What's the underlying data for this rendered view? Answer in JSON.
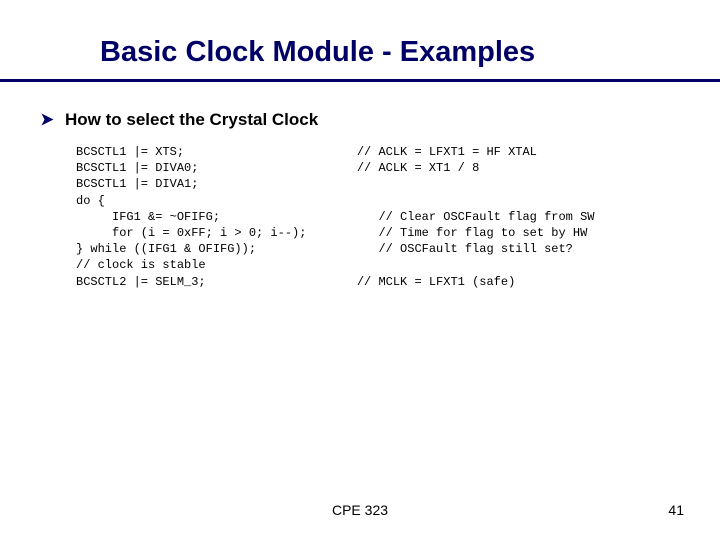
{
  "title": "Basic Clock Module - Examples",
  "bullet": "How to select the Crystal Clock",
  "code": "BCSCTL1 |= XTS;                        // ACLK = LFXT1 = HF XTAL\nBCSCTL1 |= DIVA0;                      // ACLK = XT1 / 8\nBCSCTL1 |= DIVA1;\ndo {\n     IFG1 &= ~OFIFG;                      // Clear OSCFault flag from SW\n     for (i = 0xFF; i > 0; i--);          // Time for flag to set by HW\n} while ((IFG1 & OFIFG));                 // OSCFault flag still set?\n// clock is stable\nBCSCTL2 |= SELM_3;                     // MCLK = LFXT1 (safe)",
  "footer_center": "CPE 323",
  "page_number": "41"
}
